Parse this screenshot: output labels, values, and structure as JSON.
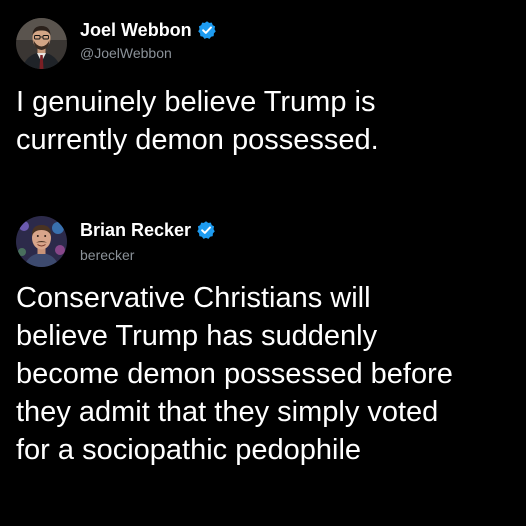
{
  "posts": [
    {
      "author": {
        "display_name": "Joel Webbon",
        "handle": "@JoelWebbon",
        "verified": true,
        "verified_icon": "verified-badge-icon"
      },
      "text": "I genuinely believe Trump is\ncurrently demon possessed."
    },
    {
      "author": {
        "display_name": "Brian Recker",
        "handle": "berecker",
        "verified": true,
        "verified_icon": "verified-badge-icon"
      },
      "text": "Conservative Christians will\nbelieve Trump has suddenly\nbecome demon possessed before\nthey admit that they simply voted\nfor a sociopathic pedophile"
    }
  ],
  "colors": {
    "background": "#000000",
    "text": "#ffffff",
    "secondary_text": "#8b9299",
    "verified_badge": "#1d9bf0"
  }
}
